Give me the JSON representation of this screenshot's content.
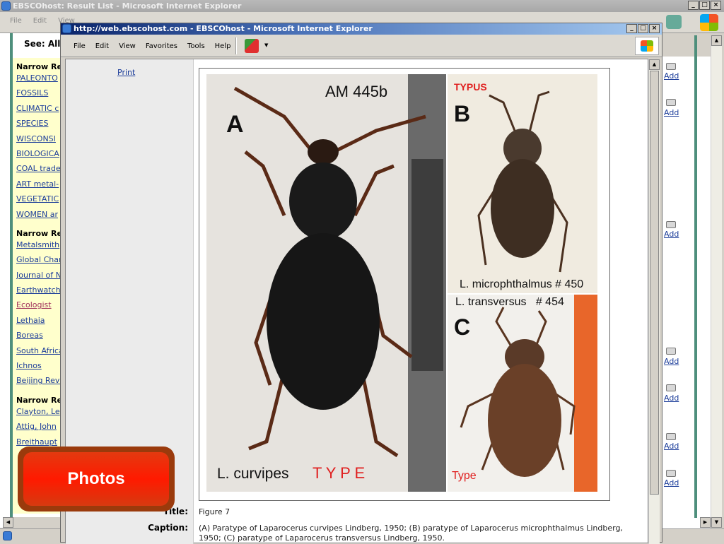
{
  "background_window": {
    "title": "EBSCOhost: Result List - Microsoft Internet Explorer",
    "menu": [
      "File",
      "Edit",
      "View"
    ],
    "see_all": "See: All F",
    "sections": [
      {
        "heading": "Narrow Re",
        "links": [
          "PALEONTO",
          "FOSSILS",
          "CLIMATIC c",
          "SPECIES",
          "WISCONSI",
          "BIOLOGICA",
          "COAL trade",
          "ART metal-",
          "VEGETATIC",
          "WOMEN ar"
        ]
      },
      {
        "heading": "Narrow Re",
        "links": [
          "Metalsmith",
          "Global Char",
          "Journal of N",
          "Earthwatch",
          "Ecologist",
          "Lethaia",
          "Boreas",
          "South Africa",
          "Ichnos",
          "Beijing Revi"
        ]
      },
      {
        "heading": "Narrow Re",
        "links": [
          "Clayton, Le",
          "Attig, John",
          "Breithaupt"
        ]
      }
    ],
    "add_label": "Add",
    "add_count": 7
  },
  "front_window": {
    "title": "http://web.ebscohost.com - EBSCOhost - Microsoft Internet Explorer",
    "menu": [
      "File",
      "Edit",
      "View",
      "Favorites",
      "Tools",
      "Help"
    ],
    "print_label": "Print",
    "figure": {
      "panel_a": {
        "letter": "A",
        "specimen": "AM 445b",
        "name": "L. curvipes",
        "type": "T Y P E"
      },
      "panel_b": {
        "letter": "B",
        "tag": "TYPUS",
        "name": "L. microphthalmus # 450"
      },
      "panel_c": {
        "letter": "C",
        "name": "L. transversus   # 454",
        "type": "Type"
      }
    },
    "title_label": "Title:",
    "title_value": "Figure 7",
    "caption_label": "Caption:",
    "caption_value": "(A) Paratype of Laparocerus curvipes Lindberg, 1950; (B) paratype of Laparocerus microphthalmus Lindberg, 1950; (C) paratype of Laparocerus transversus Lindberg, 1950."
  },
  "overlay": {
    "photos_label": "Photos"
  },
  "colors": {
    "link": "#1c3d9a",
    "visited": "#a0305a",
    "accent_red": "#ff1a00"
  }
}
